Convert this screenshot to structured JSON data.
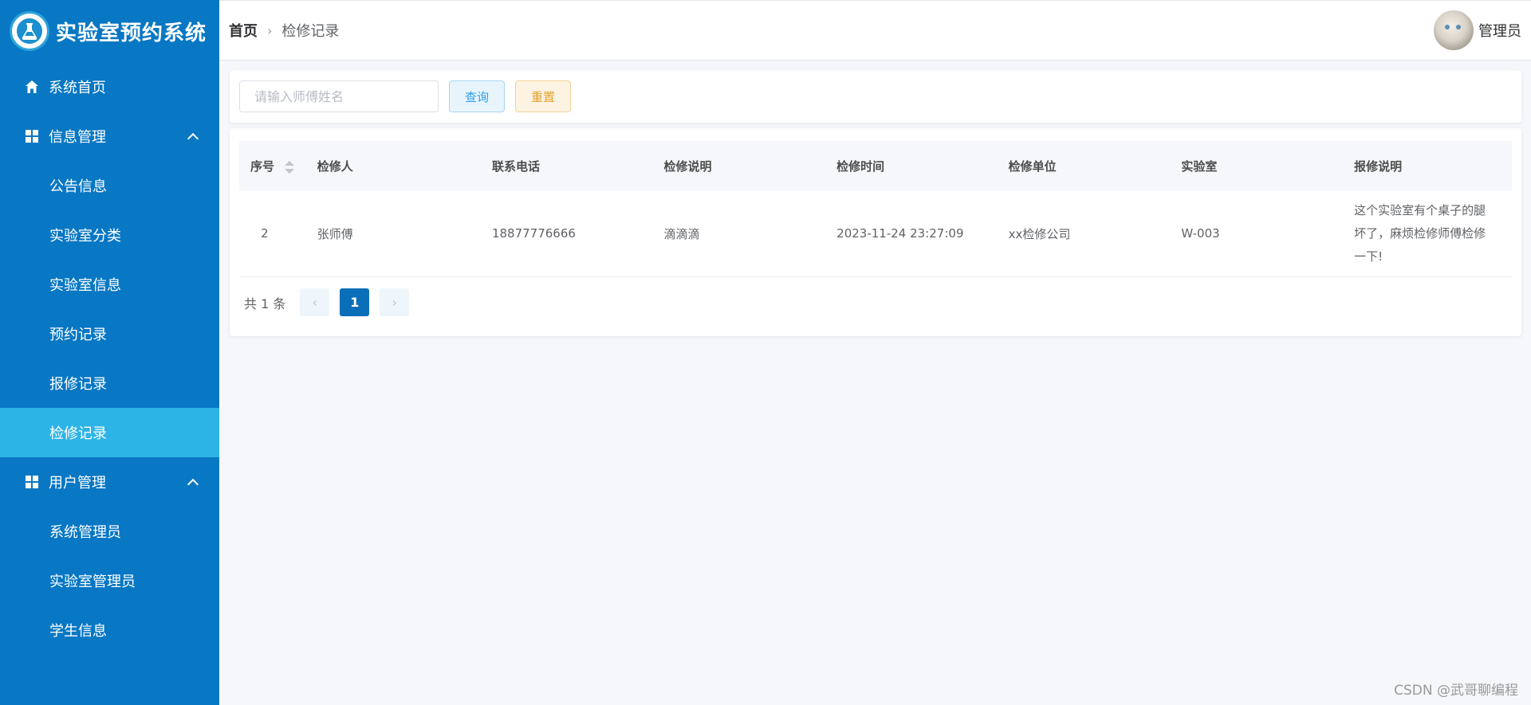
{
  "app": {
    "title": "实验室预约系统"
  },
  "sidebar": {
    "items": [
      {
        "label": "系统首页",
        "level": "top",
        "icon": "home-icon"
      },
      {
        "label": "信息管理",
        "level": "top",
        "icon": "grid-icon",
        "expanded": true
      },
      {
        "label": "公告信息",
        "level": "sub"
      },
      {
        "label": "实验室分类",
        "level": "sub"
      },
      {
        "label": "实验室信息",
        "level": "sub"
      },
      {
        "label": "预约记录",
        "level": "sub"
      },
      {
        "label": "报修记录",
        "level": "sub"
      },
      {
        "label": "检修记录",
        "level": "sub",
        "active": true
      },
      {
        "label": "用户管理",
        "level": "top",
        "icon": "grid-icon",
        "expanded": true
      },
      {
        "label": "系统管理员",
        "level": "sub"
      },
      {
        "label": "实验室管理员",
        "level": "sub"
      },
      {
        "label": "学生信息",
        "level": "sub"
      }
    ]
  },
  "header": {
    "breadcrumb_home": "首页",
    "breadcrumb_sep": "›",
    "breadcrumb_current": "检修记录",
    "user_name": "管理员"
  },
  "search": {
    "placeholder": "请输入师傅姓名",
    "value": "",
    "query_label": "查询",
    "reset_label": "重置"
  },
  "table": {
    "columns": [
      "序号",
      "检修人",
      "联系电话",
      "检修说明",
      "检修时间",
      "检修单位",
      "实验室",
      "报修说明"
    ],
    "rows": [
      {
        "idx": "2",
        "person": "张师傅",
        "phone": "18877776666",
        "desc": "滴滴滴",
        "time": "2023-11-24 23:27:09",
        "unit": "xx检修公司",
        "lab": "W-003",
        "remark": "这个实验室有个桌子的腿坏了，麻烦检修师傅检修一下!"
      }
    ]
  },
  "pager": {
    "total_text": "共 1 条",
    "prev_symbol": "‹",
    "current_page": "1",
    "next_symbol": "›"
  },
  "watermark": "CSDN @武哥聊编程",
  "colors": {
    "sidebar_bg": "#0877c4",
    "active_item_bg": "#2db4e6",
    "primary": "#0a6fb8"
  }
}
